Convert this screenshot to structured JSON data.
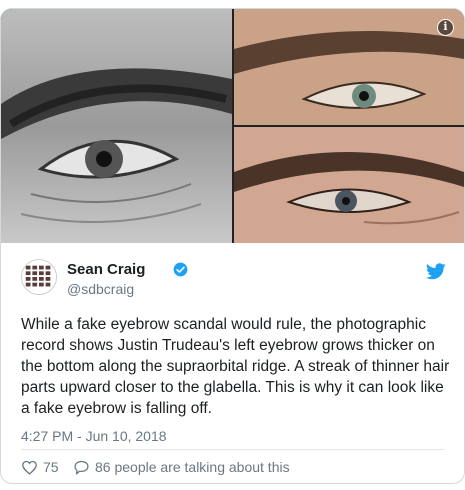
{
  "media": {
    "info_icon_glyph": "i"
  },
  "author": {
    "name": "Sean Craig",
    "handle": "@sdbcraig",
    "verified": true,
    "avatar": "pattern-avatar"
  },
  "tweet": {
    "text": "While a fake eyebrow scandal would rule, the photographic record shows Justin Trudeau's left eyebrow grows thicker on the bottom along the supraorbital ridge. A streak of thinner hair parts upward closer to the glabella. This is why it can look like a fake eyebrow is falling off.",
    "timestamp": "4:27 PM - Jun 10, 2018"
  },
  "actions": {
    "likes": "75",
    "replies_text": "86 people are talking about this"
  },
  "colors": {
    "twitter_blue": "#1da1f2",
    "muted_text": "#697882",
    "border": "#cfd9de"
  },
  "icons": [
    "info-icon",
    "verified-badge-icon",
    "twitter-bird-icon",
    "heart-icon",
    "reply-bubble-icon"
  ]
}
